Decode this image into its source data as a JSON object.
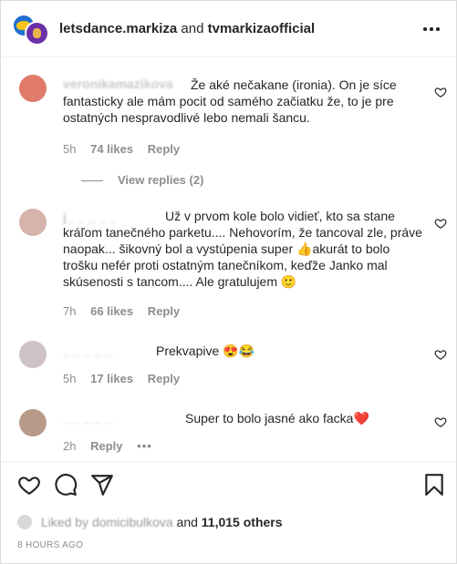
{
  "header": {
    "account1": "letsdance.markiza",
    "joiner": " and ",
    "account2": "tvmarkizaofficial"
  },
  "comments": [
    {
      "username": "veronikamazikova",
      "text": "Že aké nečakane (ironia). On je síce fantasticky ale mám pocit od samého začiatku že, to je pre ostatných nespravodlivé lebo nemali šancu.",
      "time": "5h",
      "likes": "74 likes",
      "reply": "Reply",
      "view_replies": "View replies (2)"
    },
    {
      "username": "j_ _ _ _ _",
      "text": "Už v prvom kole bolo vidieť, kto sa stane kráľom tanečného parketu.... Nehovorím, že tancoval zle, práve naopak... šikovný bol a vystúpenia super 👍akurát to bolo trošku nefér proti ostatným tanečníkom, keďže Janko mal skúsenosti s tancom.... Ale gratulujem 🙂",
      "time": "7h",
      "likes": "66 likes",
      "reply": "Reply"
    },
    {
      "username": "_ _ _ _ _",
      "text": "Prekvapive 😍😂",
      "time": "5h",
      "likes": "17 likes",
      "reply": "Reply"
    },
    {
      "username": "_ _ _ _ _",
      "text": "Super to bolo jasné ako facka❤️",
      "time": "2h",
      "reply": "Reply",
      "more": "•••"
    }
  ],
  "footer": {
    "liked_by": "Liked by",
    "liker": "domicibulkova",
    "and": "and",
    "others": "11,015 others",
    "timestamp": "8 HOURS AGO"
  }
}
